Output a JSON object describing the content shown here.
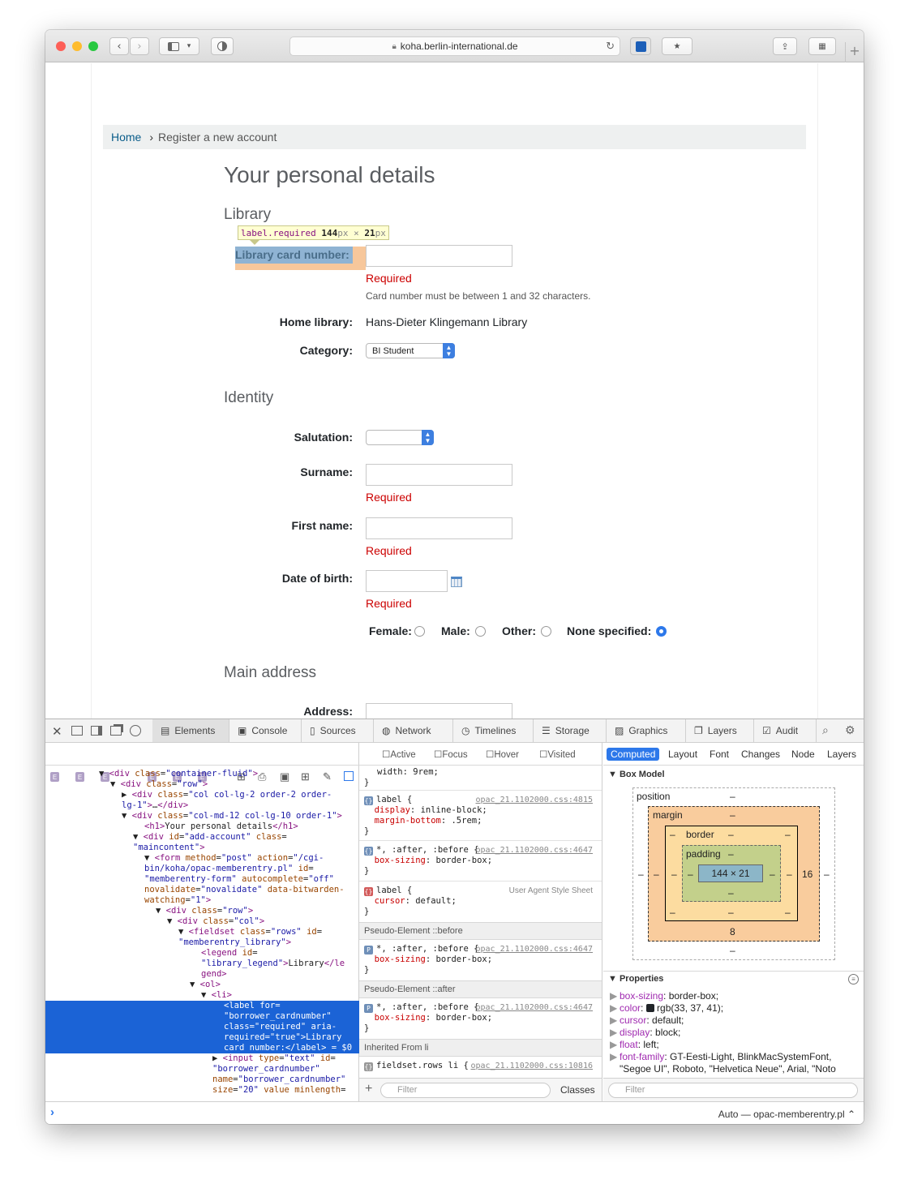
{
  "browser": {
    "url": "koha.berlin-international.de",
    "colors": {
      "close": "#fd5f57",
      "minimize": "#febc2e",
      "maximize": "#28c840"
    }
  },
  "breadcrumb": {
    "home": "Home",
    "separator": "›",
    "current": "Register a new account"
  },
  "page": {
    "title": "Your personal details",
    "library_legend": "Library",
    "tooltip": {
      "selector": "label.required",
      "width": "144",
      "times": "×",
      "height": "21",
      "unit": "px"
    },
    "card_label": "Library card number:",
    "required": "Required",
    "card_hint": "Card number must be between 1 and 32 characters.",
    "home_library_label": "Home library:",
    "home_library_value": "Hans-Dieter Klingemann Library",
    "category_label": "Category:",
    "category_value": "BI Student",
    "identity_legend": "Identity",
    "salutation_label": "Salutation:",
    "surname_label": "Surname:",
    "firstname_label": "First name:",
    "dob_label": "Date of birth:",
    "gender": {
      "female": "Female:",
      "male": "Male:",
      "other": "Other:",
      "none": "None specified:",
      "selected": "None specified"
    },
    "address_legend": "Main address",
    "address_label": "Address:"
  },
  "devtools": {
    "tabs": [
      "Elements",
      "Console",
      "Sources",
      "Network",
      "Timelines",
      "Storage",
      "Graphics",
      "Layers",
      "Audit"
    ],
    "active_tab": "Elements",
    "pseudo_states": [
      "Active",
      "Focus",
      "Hover",
      "Visited"
    ],
    "sidebar_tabs": [
      "Computed",
      "Layout",
      "Font",
      "Changes",
      "Node",
      "Layers"
    ],
    "active_sidebar_tab": "Computed",
    "dom_selected_suffix": "= $0",
    "rules": {
      "top_line": "width: 9rem;",
      "label_rule_file": "opac_21.1102000.css:4815",
      "star_rule_file": "opac_21.1102000.css:4647",
      "ua_label": "User Agent Style Sheet",
      "pseudo_before": "Pseudo-Element ::before",
      "pseudo_after": "Pseudo-Element ::after",
      "inherited": "Inherited From li",
      "fieldset_file": "opac_21.1102000.css:10816",
      "filter": "Filter",
      "classes": "Classes"
    },
    "box_model": {
      "title": "Box Model",
      "position": "position",
      "margin": "margin",
      "border": "border",
      "padding": "padding",
      "content": "144 × 21",
      "dash": "–",
      "margin_right": "16",
      "margin_bottom": "8"
    },
    "properties": {
      "title": "Properties",
      "items": [
        {
          "k": "box-sizing",
          "v": "border-box;"
        },
        {
          "k": "color",
          "v": "rgb(33, 37, 41);"
        },
        {
          "k": "cursor",
          "v": "default;"
        },
        {
          "k": "display",
          "v": "block;"
        },
        {
          "k": "float",
          "v": "left;"
        },
        {
          "k": "font-family",
          "v": "GT-Eesti-Light, BlinkMacSystemFont, \"Segoe UI\", Roboto, \"Helvetica Neue\", Arial, \"Noto"
        }
      ]
    },
    "console_context": "Auto — opac-memberentry.pl"
  }
}
